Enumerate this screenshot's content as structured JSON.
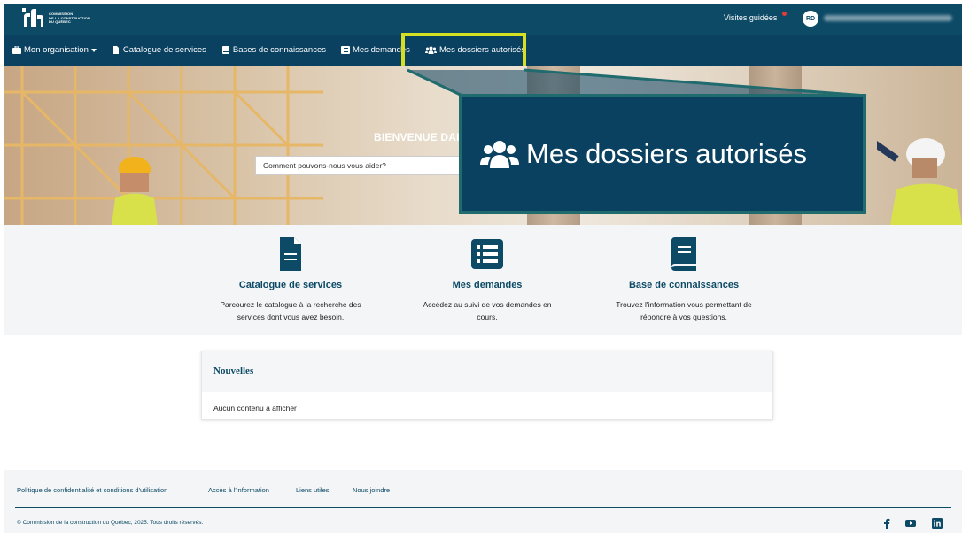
{
  "header": {
    "logo_lines": [
      "COMMISSION",
      "DE LA CONSTRUCTION",
      "DU QUÉBEC"
    ],
    "visits_label": "Visites guidées",
    "avatar_initials": "RD"
  },
  "nav": {
    "items": [
      {
        "label": "Mon organisation",
        "icon": "briefcase-icon",
        "has_dropdown": true
      },
      {
        "label": "Catalogue de services",
        "icon": "document-icon"
      },
      {
        "label": "Bases de connaissances",
        "icon": "book-icon"
      },
      {
        "label": "Mes demandes",
        "icon": "list-icon"
      },
      {
        "label": "Mes dossiers autorisés",
        "icon": "users-icon",
        "highlighted": true
      }
    ]
  },
  "hero": {
    "welcome": "BIENVENUE DAI",
    "search_placeholder": "Comment pouvons-nous vous aider?"
  },
  "callout": {
    "label": "Mes dossiers autorisés",
    "icon": "users-icon"
  },
  "services": [
    {
      "title": "Catalogue de services",
      "desc_lines": [
        "Parcourez le catalogue à la recherche des",
        "services dont vous avez besoin."
      ],
      "icon": "document-icon"
    },
    {
      "title": "Mes demandes",
      "desc_lines": [
        "Accédez au suivi de vos demandes en",
        "cours."
      ],
      "icon": "list-icon"
    },
    {
      "title": "Base de connaissances",
      "desc_lines": [
        "Trouvez l'information vous permettant de",
        "répondre à vos questions."
      ],
      "icon": "book-icon"
    }
  ],
  "news": {
    "title": "Nouvelles",
    "empty": "Aucun contenu à afficher"
  },
  "footer": {
    "links": [
      "Politique de confidentialité et conditions d'utilisation",
      "Accès à l'information",
      "Liens utiles",
      "Nous joindre"
    ],
    "copyright": "© Commission de la construction du Québec, 2025. Tous droits réservés.",
    "social": [
      "facebook-icon",
      "youtube-icon",
      "linkedin-icon"
    ]
  },
  "colors": {
    "brand": "#0d4a66",
    "highlight": "#d7df23",
    "alert_dot": "#e23b3b"
  }
}
